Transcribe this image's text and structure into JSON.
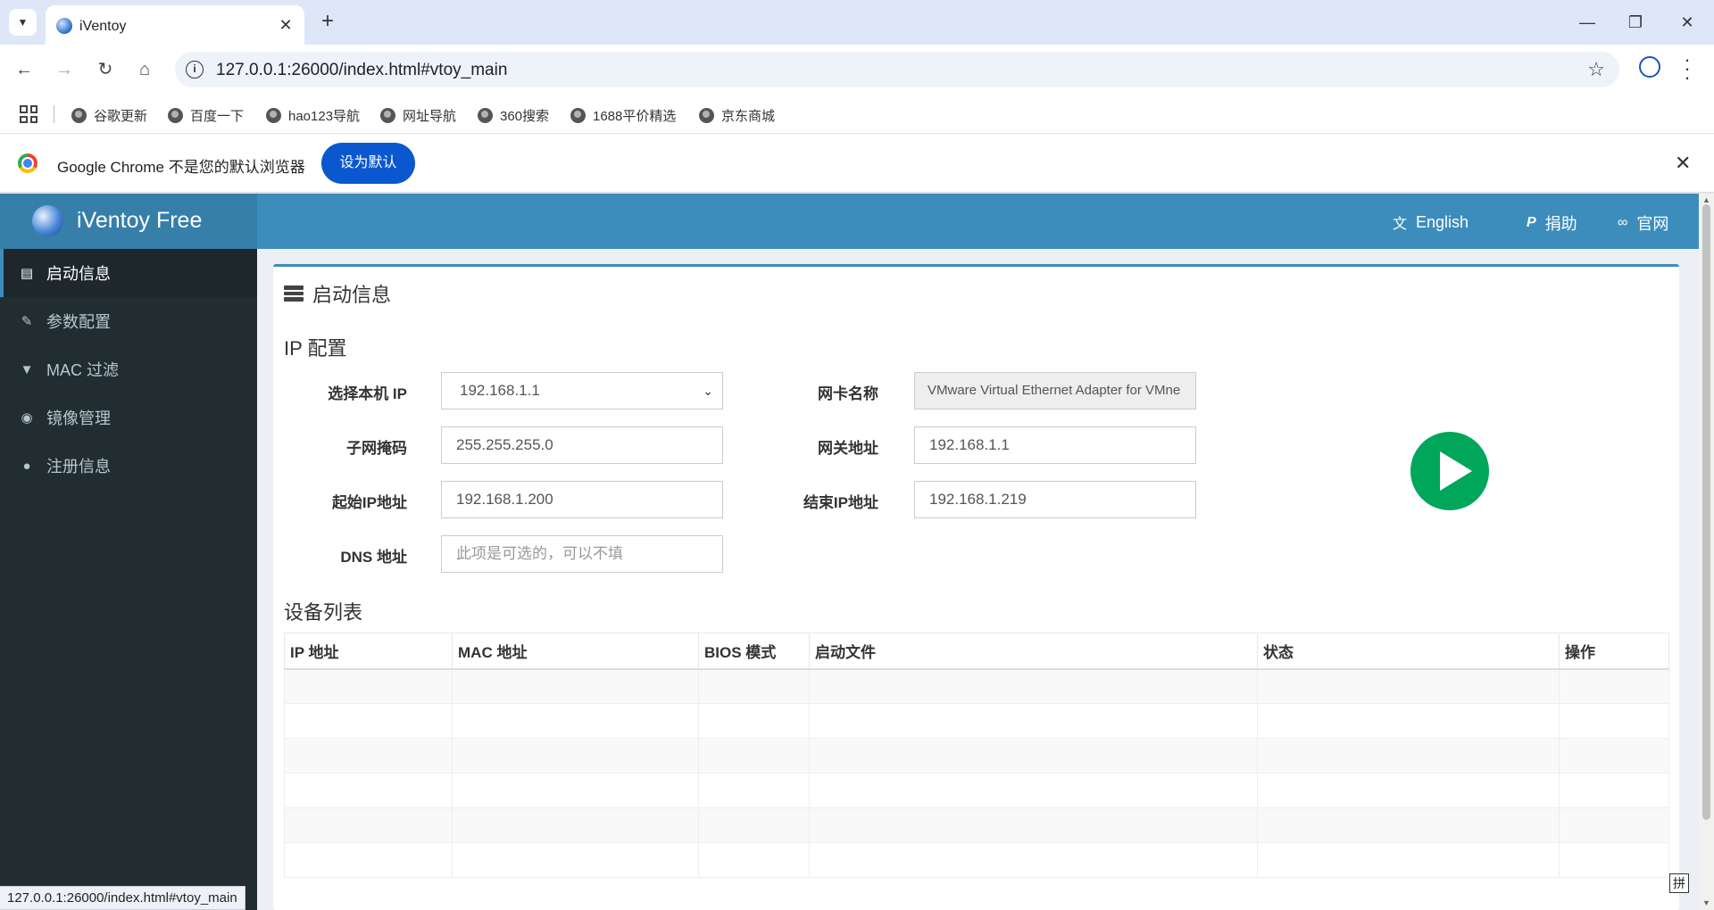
{
  "browser": {
    "tab_title": "iVentoy",
    "tab_close": "✕",
    "new_tab": "+",
    "window_controls": {
      "minimize": "—",
      "restore": "❐",
      "close": "✕"
    },
    "url": "127.0.0.1:26000/index.html#vtoy_main",
    "bookmarks": [
      "谷歌更新",
      "百度一下",
      "hao123导航",
      "网址导航",
      "360搜索",
      "1688平价精选",
      "京东商城"
    ],
    "infobar": {
      "text": "Google Chrome 不是您的默认浏览器",
      "button": "设为默认",
      "close": "✕"
    },
    "status_url": "127.0.0.1:26000/index.html#vtoy_main"
  },
  "app": {
    "logo_text": "iVentoy Free",
    "header": {
      "language": "English",
      "donate": "捐助",
      "website": "官网"
    },
    "sidebar": [
      {
        "label": "启动信息",
        "icon": "server-icon",
        "active": true
      },
      {
        "label": "参数配置",
        "icon": "wrench-icon",
        "active": false
      },
      {
        "label": "MAC 过滤",
        "icon": "filter-icon",
        "active": false
      },
      {
        "label": "镜像管理",
        "icon": "disc-icon",
        "active": false
      },
      {
        "label": "注册信息",
        "icon": "user-icon",
        "active": false
      }
    ],
    "box_title": "启动信息",
    "ip_config": {
      "title": "IP 配置",
      "select_ip_label": "选择本机 IP",
      "select_ip_value": "192.168.1.1",
      "nic_label": "网卡名称",
      "nic_value": "VMware Virtual Ethernet Adapter for VMne",
      "subnet_label": "子网掩码",
      "subnet_value": "255.255.255.0",
      "gateway_label": "网关地址",
      "gateway_value": "192.168.1.1",
      "start_ip_label": "起始IP地址",
      "start_ip_value": "192.168.1.200",
      "end_ip_label": "结束IP地址",
      "end_ip_value": "192.168.1.219",
      "dns_label": "DNS 地址",
      "dns_placeholder": "此项是可选的，可以不填"
    },
    "device_list": {
      "title": "设备列表",
      "columns": [
        "IP 地址",
        "MAC 地址",
        "BIOS 模式",
        "启动文件",
        "状态",
        "操作"
      ],
      "rows": []
    },
    "ime_indicator": "拼"
  },
  "colors": {
    "header": "#3c8dbc",
    "sidebar": "#222d32",
    "start_button": "#00a65a",
    "chrome_blue": "#0b57d0"
  }
}
